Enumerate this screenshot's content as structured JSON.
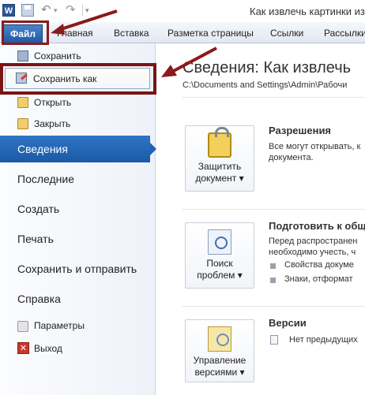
{
  "title_bar": {
    "title": "Как извлечь картинки из"
  },
  "quick_access": {
    "app_icon_letter": "W"
  },
  "ribbon_tabs": [
    "Файл",
    "Главная",
    "Вставка",
    "Разметка страницы",
    "Ссылки",
    "Рассылки"
  ],
  "backstage_nav": {
    "commands": {
      "save": "Сохранить",
      "save_as": "Сохранить как",
      "open": "Открыть",
      "close": "Закрыть"
    },
    "items": {
      "info": "Сведения",
      "recent": "Последние",
      "create": "Создать",
      "print": "Печать",
      "send": "Сохранить и отправить",
      "help": "Справка",
      "params": "Параметры",
      "exit": "Выход"
    }
  },
  "info_panel": {
    "title": "Сведения: Как извлечь",
    "path": "C:\\Documents and Settings\\Admin\\Рабочи",
    "permissions": {
      "button_line1": "Защитить",
      "button_line2": "документ ▾",
      "heading": "Разрешения",
      "text_line1": "Все могут открывать, к",
      "text_line2": "документа."
    },
    "prepare": {
      "button_line1": "Поиск",
      "button_line2": "проблем ▾",
      "heading": "Подготовить к общ",
      "text_line1": "Перед распространен",
      "text_line2": "необходимо учесть, ч",
      "bullet1": "Свойства докуме",
      "bullet2": "Знаки, отформат"
    },
    "versions": {
      "button_line1": "Управление",
      "button_line2": "версиями ▾",
      "heading": "Версии",
      "text": "Нет предыдущих"
    }
  },
  "colors": {
    "file_tab": "#1e5aa6",
    "active_nav": "#1f62b3",
    "annotation": "#8b1a1a"
  }
}
